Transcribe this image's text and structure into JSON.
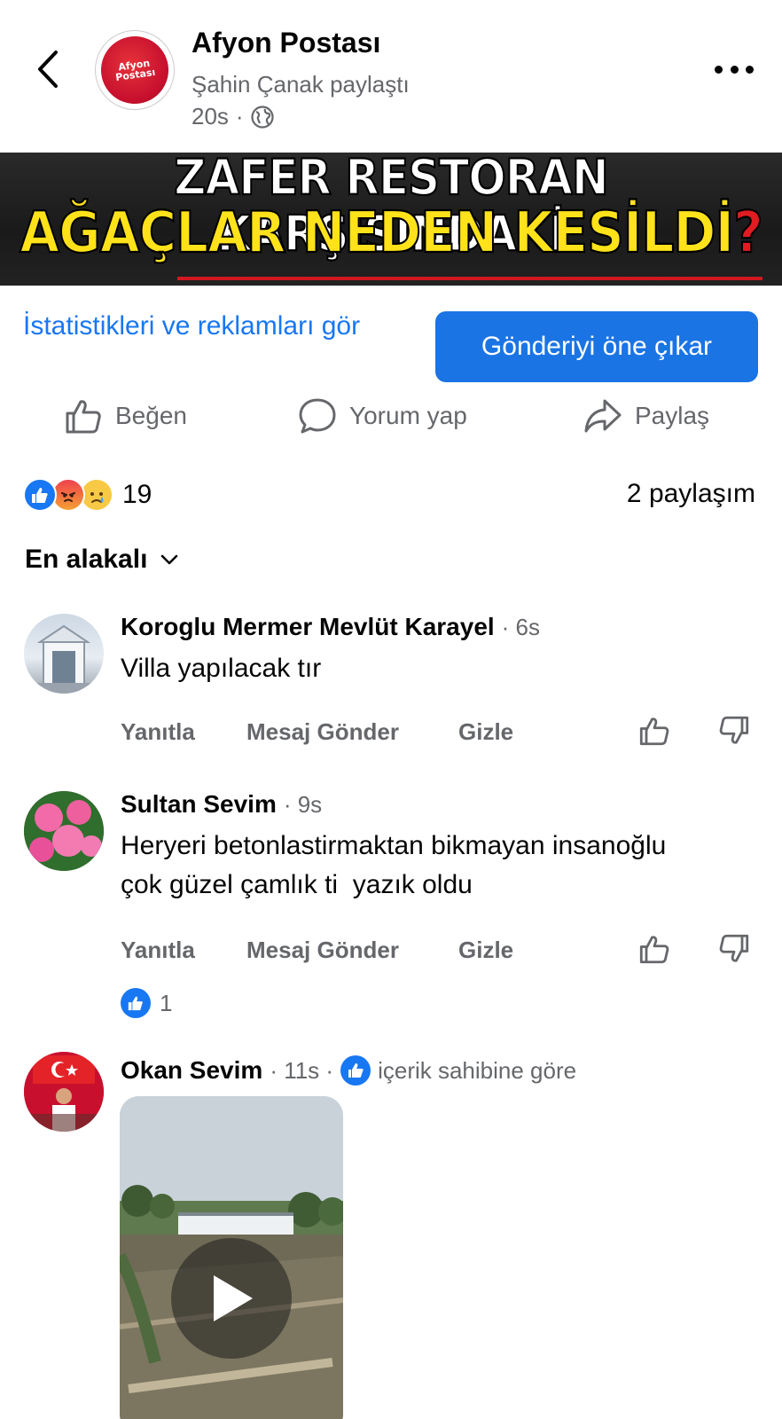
{
  "header": {
    "page_name": "Afyon Postası",
    "shared_by": "Şahin Çanak paylaştı",
    "time": "20s",
    "separator": "·",
    "logo_text_top": "Afyon",
    "logo_text_bottom": "Postası"
  },
  "banner": {
    "line1": "ZAFER RESTORAN KARŞISINDAKİ",
    "line2": "AĞAÇLAR NEDEN KESİLDİ",
    "line2_mark": "?"
  },
  "promote": {
    "stats_link": "İstatistikleri ve reklamları gör",
    "boost_button": "Gönderiyi öne çıkar"
  },
  "actions": {
    "like": "Beğen",
    "comment": "Yorum yap",
    "share": "Paylaş"
  },
  "summary": {
    "reaction_count": "19",
    "shares": "2 paylaşım"
  },
  "sort": {
    "label": "En alakalı"
  },
  "comments": [
    {
      "author": "Koroglu Mermer Mevlüt Karayel",
      "time": "· 6s",
      "text": "Villa yapılacak tır",
      "reply": "Yanıtla",
      "message": "Mesaj Gönder",
      "hide": "Gizle"
    },
    {
      "author": "Sultan Sevim",
      "time": "· 9s",
      "text_line1": "Heryeri betonlastirmaktan bikmayan insanoğlu",
      "text_line2": "çok güzel çamlık ti  yazık oldu",
      "reply": "Yanıtla",
      "message": "Mesaj Gönder",
      "hide": "Gizle",
      "like_count": "1"
    },
    {
      "author": "Okan Sevim",
      "time": "· 11s ·",
      "badge_text": "içerik sahibine göre"
    }
  ],
  "colors": {
    "accent": "#1877f2",
    "boost_button": "#1b74e4",
    "secondary_text": "#65676b",
    "banner_yellow": "#ffe21a"
  }
}
